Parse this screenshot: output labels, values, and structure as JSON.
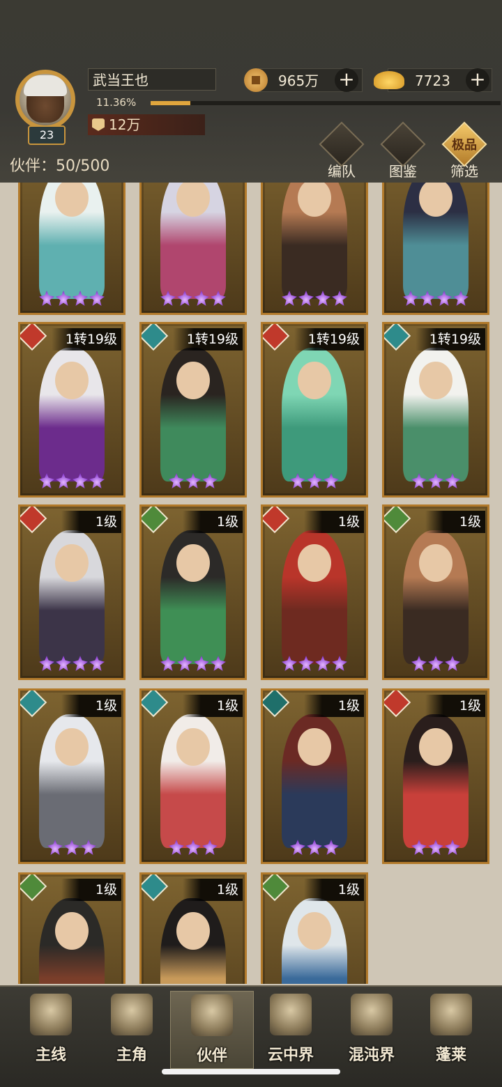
{
  "player": {
    "name": "武当王也",
    "level": "23",
    "exp_percent": "11.36%",
    "exp_fraction": 0.1136,
    "power": "12万"
  },
  "currency": {
    "coins": "965万",
    "ingots": "7723",
    "plus": "+"
  },
  "partners": {
    "count_label": "伙伴：50/500"
  },
  "menu": {
    "team": "编队",
    "codex": "图鉴",
    "filter": "筛选",
    "filter_badge": "极品"
  },
  "cards": [
    {
      "level": "",
      "element": "none",
      "stars": 4,
      "palette": "cyan"
    },
    {
      "level": "",
      "element": "none",
      "stars": 4,
      "palette": "pink"
    },
    {
      "level": "",
      "element": "none",
      "stars": 4,
      "palette": "tan"
    },
    {
      "level": "",
      "element": "none",
      "stars": 4,
      "palette": "teal"
    },
    {
      "level": "1转19级",
      "element": "fox",
      "stars": 4,
      "palette": "purple"
    },
    {
      "level": "1转19级",
      "element": "water",
      "stars": 3,
      "palette": "green-red"
    },
    {
      "level": "1转19级",
      "element": "fox",
      "stars": 3,
      "palette": "mint"
    },
    {
      "level": "1转19级",
      "element": "water",
      "stars": 3,
      "palette": "white"
    },
    {
      "level": "1级",
      "element": "fox",
      "stars": 4,
      "palette": "grey"
    },
    {
      "level": "1级",
      "element": "wood",
      "stars": 4,
      "palette": "green"
    },
    {
      "level": "1级",
      "element": "fox",
      "stars": 4,
      "palette": "red"
    },
    {
      "level": "1级",
      "element": "wood",
      "stars": 3,
      "palette": "tan"
    },
    {
      "level": "1级",
      "element": "water",
      "stars": 3,
      "palette": "silver"
    },
    {
      "level": "1级",
      "element": "water",
      "stars": 3,
      "palette": "white-red"
    },
    {
      "level": "1级",
      "element": "cat",
      "stars": 3,
      "palette": "navy"
    },
    {
      "level": "1级",
      "element": "fox",
      "stars": 3,
      "palette": "crimson"
    },
    {
      "level": "1级",
      "element": "wood",
      "stars": 0,
      "palette": "dark"
    },
    {
      "level": "1级",
      "element": "water",
      "stars": 0,
      "palette": "black"
    },
    {
      "level": "1级",
      "element": "wood",
      "stars": 0,
      "palette": "blue"
    }
  ],
  "nav": {
    "tabs": [
      "主线",
      "主角",
      "伙伴",
      "云中界",
      "混沌界",
      "蓬莱"
    ],
    "active_index": 2
  },
  "colors": {
    "element_fox": "#c0392b",
    "element_water": "#2e8b8b",
    "element_wood": "#4f8a3a",
    "element_cat": "#1f6f6a",
    "card_border": "#b27a2b",
    "star": "#9348d6"
  }
}
